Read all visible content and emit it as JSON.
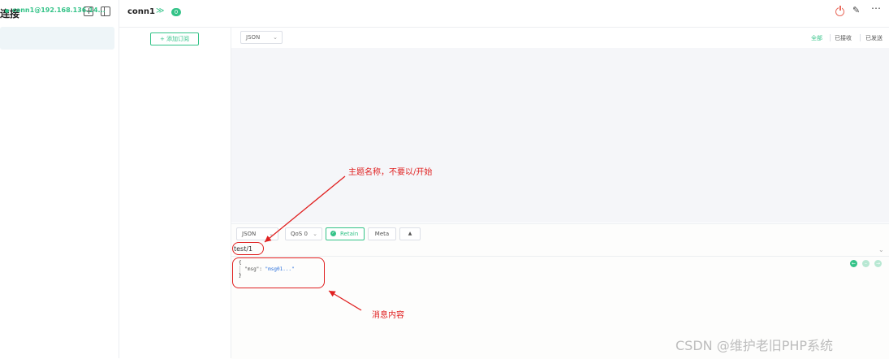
{
  "sidebar": {
    "title": "连接",
    "add_icon": "plus-square-icon",
    "layout_icon": "layout-panel-icon",
    "connections": [
      {
        "label": "conn1@192.168.136.14...",
        "status_color": "#34c388"
      }
    ]
  },
  "header": {
    "title": "conn1",
    "chevron_glyph": "≫",
    "badge_count": "0",
    "icons": [
      "power-icon",
      "edit-icon",
      "more-icon"
    ]
  },
  "topics": {
    "add_subscription_label": "+ 添加订阅"
  },
  "messages": {
    "format": "JSON",
    "filters": [
      "全部",
      "已接收",
      "已发送"
    ],
    "active_filter": "全部"
  },
  "publish": {
    "format": "JSON",
    "qos": "QoS 0",
    "retain_label": "Retain",
    "meta_label": "Meta",
    "up_glyph": "▲",
    "topic": "test/1",
    "payload_line1": "{",
    "payload_key": "\"msg\"",
    "payload_colon": ": ",
    "payload_value": "\"msg01...\"",
    "payload_line3": "}"
  },
  "annotations": {
    "topic_note": "主题名称，不要以/开始",
    "payload_note": "消息内容",
    "color": "#e02020"
  },
  "watermark": "CSDN @维护老旧PHP系统",
  "colors": {
    "accent": "#34c388",
    "annotation": "#e02020",
    "panel_bg": "#f5f6f9"
  }
}
